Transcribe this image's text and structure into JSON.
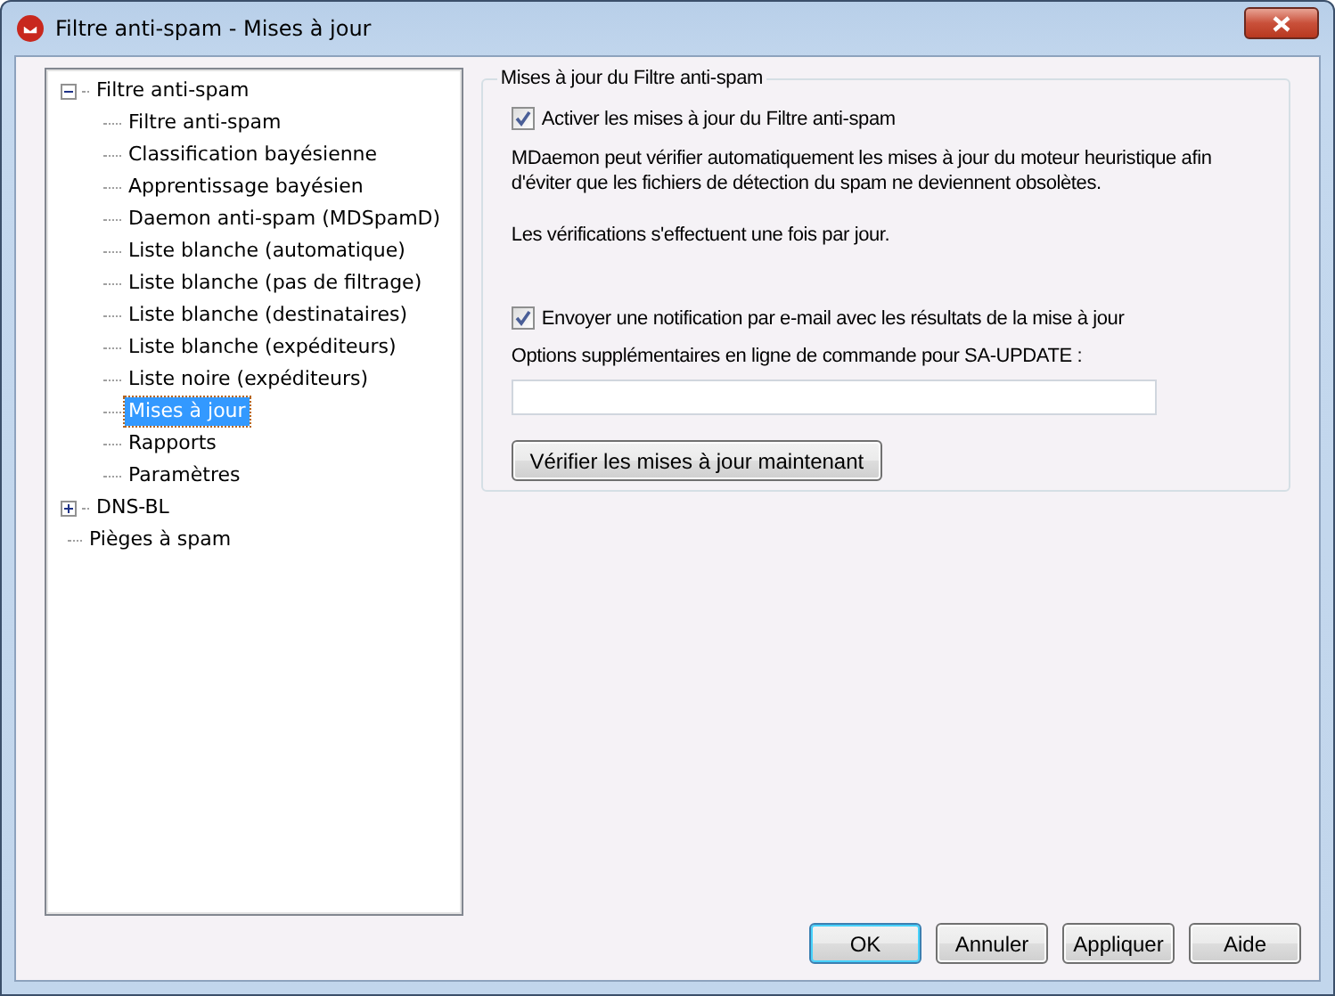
{
  "window": {
    "title": "Filtre anti-spam - Mises à jour"
  },
  "tree": [
    {
      "label": "Filtre anti-spam",
      "selected": false,
      "expanded": true,
      "children": [
        {
          "label": "Filtre anti-spam",
          "selected": false
        },
        {
          "label": "Classification bayésienne",
          "selected": false
        },
        {
          "label": "Apprentissage bayésien",
          "selected": false
        },
        {
          "label": "Daemon anti-spam (MDSpamD)",
          "selected": false
        },
        {
          "label": "Liste blanche (automatique)",
          "selected": false
        },
        {
          "label": "Liste blanche (pas de filtrage)",
          "selected": false
        },
        {
          "label": "Liste blanche (destinataires)",
          "selected": false
        },
        {
          "label": "Liste blanche (expéditeurs)",
          "selected": false
        },
        {
          "label": "Liste noire (expéditeurs)",
          "selected": false
        },
        {
          "label": "Mises à jour",
          "selected": true
        },
        {
          "label": "Rapports",
          "selected": false
        },
        {
          "label": "Paramètres",
          "selected": false
        }
      ]
    },
    {
      "label": "DNS-BL",
      "selected": false,
      "expanded": false
    },
    {
      "label": "Pièges à spam",
      "selected": false
    }
  ],
  "group": {
    "title": "Mises à jour du Filtre anti-spam",
    "enable": {
      "label": "Activer les mises à jour du Filtre anti-spam",
      "checked": true
    },
    "description": "MDaemon peut vérifier automatiquement les mises à jour du moteur heuristique afin d'éviter que les fichiers de détection du spam ne deviennent obsolètes.",
    "frequency": "Les vérifications s'effectuent une fois par jour.",
    "notify": {
      "label": "Envoyer une notification par e-mail avec les résultats de la mise à jour",
      "checked": true
    },
    "options_label": "Options supplémentaires en ligne de commande pour SA-UPDATE :",
    "check_button": "Vérifier les mises à jour maintenant"
  },
  "buttons": [
    {
      "label": "OK",
      "default": true
    },
    {
      "label": "Annuler",
      "default": false
    },
    {
      "label": "Appliquer",
      "default": false
    },
    {
      "label": "Aide",
      "default": false
    }
  ]
}
